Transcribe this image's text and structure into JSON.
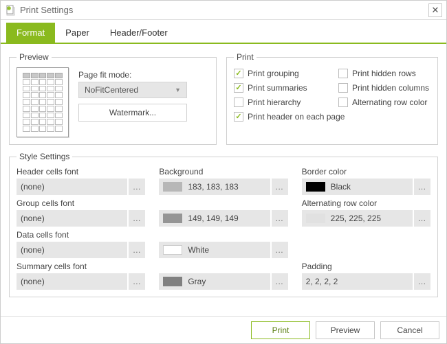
{
  "window": {
    "title": "Print Settings"
  },
  "tabs": {
    "format": "Format",
    "paper": "Paper",
    "header_footer": "Header/Footer",
    "active": "format"
  },
  "preview": {
    "legend": "Preview",
    "page_fit_label": "Page fit mode:",
    "page_fit_value": "NoFitCentered",
    "watermark_button": "Watermark..."
  },
  "print": {
    "legend": "Print",
    "options": {
      "grouping": {
        "label": "Print grouping",
        "checked": true
      },
      "hidden_rows": {
        "label": "Print hidden rows",
        "checked": false
      },
      "summaries": {
        "label": "Print summaries",
        "checked": true
      },
      "hidden_columns": {
        "label": "Print hidden columns",
        "checked": false
      },
      "hierarchy": {
        "label": "Print hierarchy",
        "checked": false
      },
      "alt_row_color": {
        "label": "Alternating row color",
        "checked": false
      },
      "header_each_page": {
        "label": "Print header on each page",
        "checked": true
      }
    }
  },
  "style": {
    "legend": "Style Settings",
    "header_font_label": "Header cells font",
    "background_label": "Background",
    "border_color_label": "Border color",
    "group_font_label": "Group cells font",
    "alt_row_color_label": "Alternating row color",
    "data_font_label": "Data cells font",
    "summary_font_label": "Summary cells font",
    "padding_label": "Padding",
    "values": {
      "header_font": "(none)",
      "header_bg": "183, 183, 183",
      "border_color": "Black",
      "group_font": "(none)",
      "group_bg": "149, 149, 149",
      "alt_row_color": "225, 225, 225",
      "data_font": "(none)",
      "data_bg": "White",
      "summary_font": "(none)",
      "summary_bg": "Gray",
      "padding": "2, 2, 2, 2"
    },
    "colors": {
      "header_bg": "#b7b7b7",
      "border_color": "#000000",
      "group_bg": "#959595",
      "alt_row_color": "#e1e1e1",
      "data_bg": "#ffffff",
      "summary_bg": "#808080"
    }
  },
  "footer": {
    "print": "Print",
    "preview": "Preview",
    "cancel": "Cancel"
  }
}
